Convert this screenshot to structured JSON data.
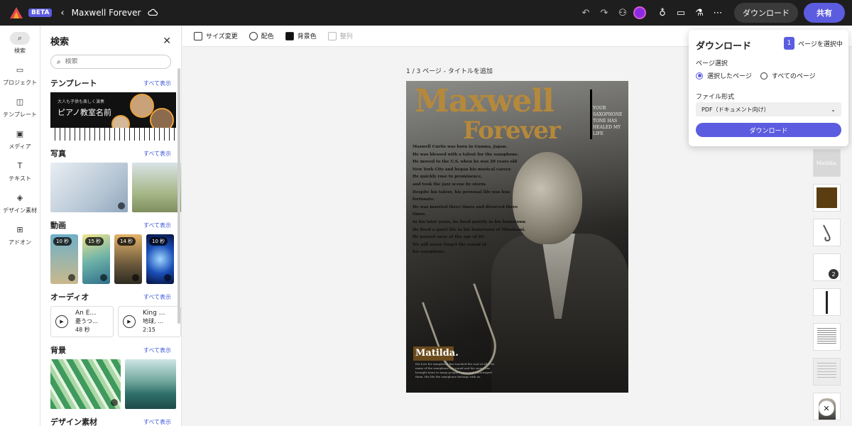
{
  "app": {
    "beta_label": "BETA",
    "document_title": "Maxwell Forever"
  },
  "topbar": {
    "download_label": "ダウンロード",
    "share_label": "共有"
  },
  "rail": {
    "items": [
      {
        "label": "検索",
        "icon": "search-icon"
      },
      {
        "label": "プロジェクト",
        "icon": "folder-icon"
      },
      {
        "label": "テンプレート",
        "icon": "template-icon"
      },
      {
        "label": "メディア",
        "icon": "media-icon"
      },
      {
        "label": "テキスト",
        "icon": "text-icon"
      },
      {
        "label": "デザイン素材",
        "icon": "shapes-icon"
      },
      {
        "label": "アドオン",
        "icon": "addon-icon"
      }
    ]
  },
  "panel": {
    "title": "検索",
    "search_placeholder": "検索",
    "see_all": "すべて表示",
    "sections": {
      "templates": "テンプレート",
      "photos": "写真",
      "videos": "動画",
      "audio": "オーディオ",
      "backgrounds": "背景",
      "design": "デザイン素材"
    },
    "template_card": {
      "subtitle": "大人も子供も楽しく演奏",
      "title": "ピアノ教室名前"
    },
    "video_durations": [
      "10 秒",
      "15 秒",
      "14 秒",
      "10 秒"
    ],
    "audio_items": [
      {
        "name": "An E…",
        "mood": "憂うつ…",
        "duration": "48 秒"
      },
      {
        "name": "King …",
        "mood": "地球, …",
        "duration": "2:15"
      }
    ]
  },
  "toolbar": {
    "resize": "サイズ変更",
    "color": "配色",
    "background": "背景色",
    "align": "整列"
  },
  "canvas": {
    "page_label": "1 / 3 ページ - タイトルを追加"
  },
  "poster": {
    "title_line1": "Maxwell",
    "title_line2": "Forever",
    "side_text": "YOUR SAXOPHONE TONE HAS HEALED MY LIFE",
    "body_lines": [
      "Maxwell Curtis was born in Gunma, Japan.",
      "He was blessed with a talent for the saxophone.",
      "He moved to the U.S. when he was 20 years old",
      "New York City and began his musical career.",
      "He quickly rose to prominence,",
      "and took the jazz scene by storm.",
      "Despite his talent, his personal life was less fortunate.",
      "He was married three times and divorced three times.",
      "In his later years, he lived quietly in his hometown",
      "He lived a quiet life in his hometown of Minakami.",
      "He passed away at the age of 85.",
      "We will never forget the sound of",
      "his saxophone."
    ],
    "matilda": "Matilda.",
    "matilda_text": "His love for saxophone has touched the soul of all. The name of the saxophone his sound and his sound has brought tears to many people's eyes and encouraged them. His life the saxophone belongs with us."
  },
  "thumbs": {
    "thumb1_text": "Matilda.",
    "page_badge": "2"
  },
  "download_popover": {
    "title": "ダウンロード",
    "selected_count": "1",
    "select_pages": "ページを選択中",
    "page_selection_label": "ページ選択",
    "option_selected": "選択したページ",
    "option_all": "すべてのページ",
    "file_format_label": "ファイル形式",
    "file_format_value": "PDF（ドキュメント向け）",
    "download_button": "ダウンロード"
  },
  "colors": {
    "accent": "#5c5ce0",
    "topbar": "#1e1e1e",
    "gold": "#b5893b"
  }
}
